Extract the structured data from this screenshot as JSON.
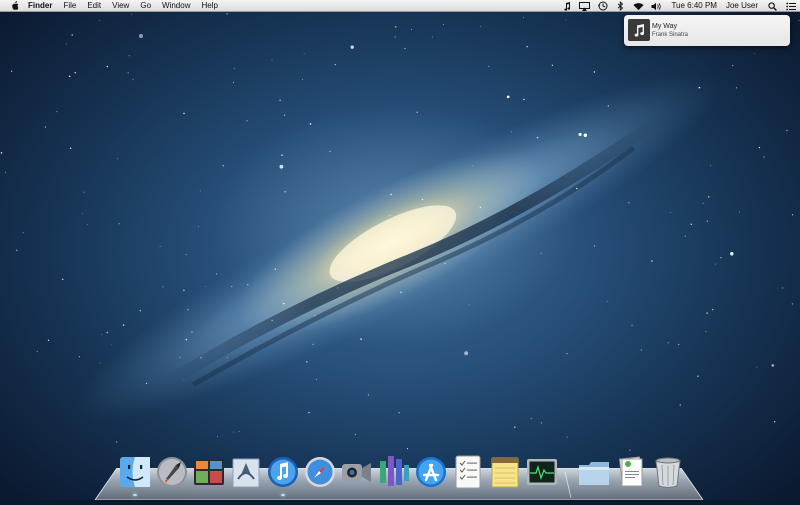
{
  "menubar": {
    "app_name": "Finder",
    "menus": [
      "File",
      "Edit",
      "View",
      "Go",
      "Window",
      "Help"
    ],
    "clock": "Tue 6:40 PM",
    "user": "Joe User",
    "status_icons": [
      "music-note-icon",
      "airplay-icon",
      "time-machine-icon",
      "bluetooth-icon",
      "wifi-icon",
      "volume-icon",
      "search-icon",
      "list-icon"
    ]
  },
  "notification": {
    "title": "My Way",
    "subtitle": "Frank Sinatra",
    "icon": "music-note-icon"
  },
  "dock": {
    "apps": [
      {
        "name": "finder-icon",
        "running": true
      },
      {
        "name": "launchpad-icon",
        "running": false
      },
      {
        "name": "mission-control-icon",
        "running": false
      },
      {
        "name": "mail-icon",
        "running": false
      },
      {
        "name": "itunes-icon",
        "running": true
      },
      {
        "name": "safari-icon",
        "running": false
      },
      {
        "name": "facetime-icon",
        "running": false
      },
      {
        "name": "equalizer-app-icon",
        "running": false
      },
      {
        "name": "app-store-icon",
        "running": false
      },
      {
        "name": "reminders-icon",
        "running": false
      },
      {
        "name": "notes-icon",
        "running": false
      },
      {
        "name": "activity-monitor-icon",
        "running": false
      },
      {
        "name": "applications-folder-icon",
        "running": false
      },
      {
        "name": "documents-stack-icon",
        "running": false
      },
      {
        "name": "trash-icon",
        "running": false
      }
    ]
  },
  "colors": {
    "menubar": "#e6e6e6",
    "wallpaper_deep": "#0b1a30",
    "wallpaper_mid": "#27507a",
    "galaxy_core": "#fff3c8"
  }
}
